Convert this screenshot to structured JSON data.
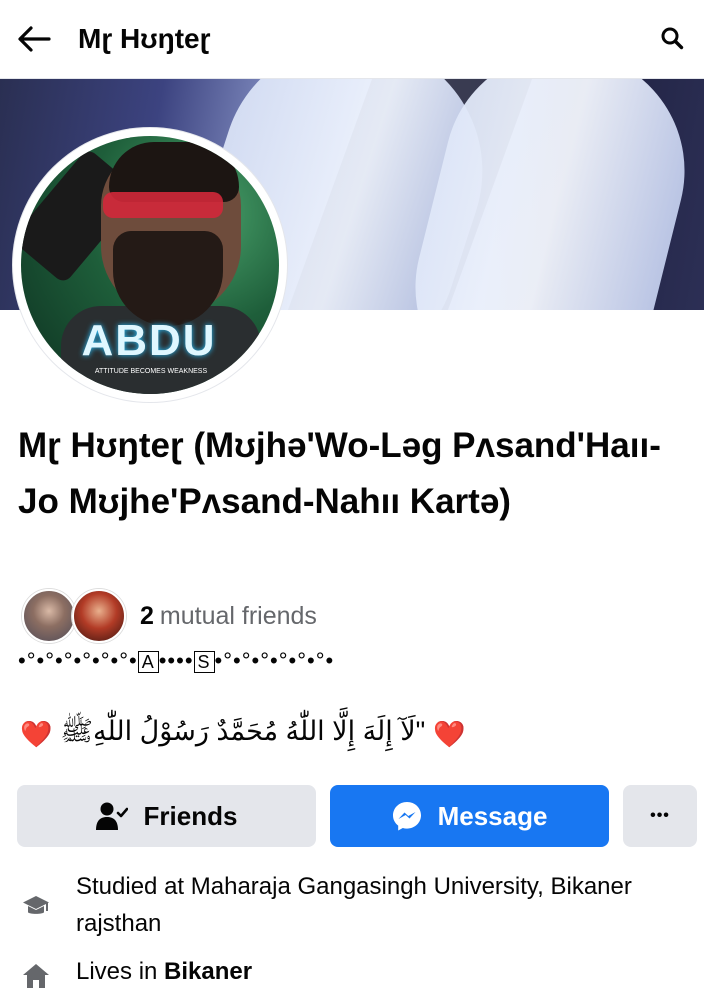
{
  "header": {
    "title": "Mɽ Hʊŋteɽ"
  },
  "profile": {
    "name": "Mɽ Hʊŋteɽ (Mʊjhə'Wo-Ləg Pʌsand'Haıı-Jo Mʊjhe'Pʌsand-Nahıı Kartə)",
    "mutual_count": "2",
    "mutual_label": "mutual friends",
    "deco_part1": "•°•°•°•°•°•°•",
    "deco_box1": "A",
    "deco_part2": "••••",
    "deco_box2": "S",
    "deco_part3": "•°•°•°•°•°•°•",
    "bio_quote": "\"لَآ إِلَهَ إِلَّا اللّٰهُ مُحَمَّدٌ رَسُوْلُ اللّٰهِﷺ",
    "bio_heart": "❤️",
    "avatar_logo": "ABDU",
    "avatar_logo_sub": "ATTITUDE BECOMES WEAKNESS"
  },
  "actions": {
    "friends_label": "Friends",
    "message_label": "Message",
    "more_label": "•••"
  },
  "details": {
    "education": "Studied at Maharaja Gangasingh University, Bikaner rajsthan",
    "lives_prefix": "Lives in",
    "lives_city": "Bikaner"
  },
  "colors": {
    "accent": "#1877f2",
    "button_gray": "#e4e6eb",
    "heart": "#e0243a"
  }
}
